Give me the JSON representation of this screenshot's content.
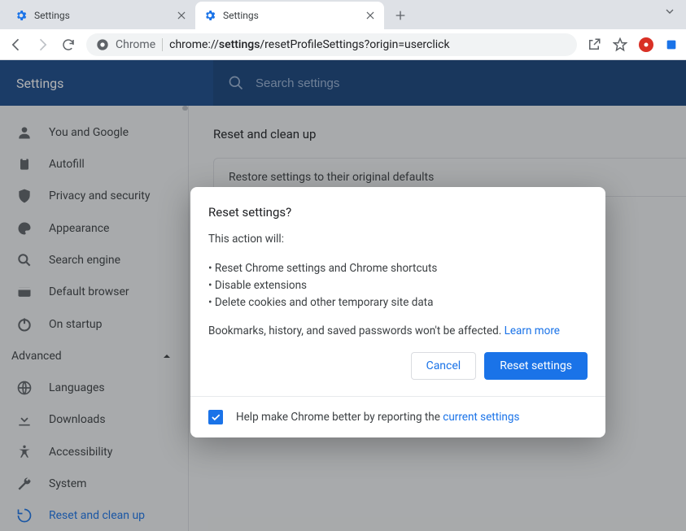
{
  "tabs": [
    {
      "label": "Settings",
      "active": false
    },
    {
      "label": "Settings",
      "active": true
    }
  ],
  "address": {
    "scheme_label": "Chrome",
    "url_prefix": "chrome://",
    "url_bold": "settings",
    "url_rest": "/resetProfileSettings?origin=userclick"
  },
  "app": {
    "title": "Settings",
    "search_placeholder": "Search settings"
  },
  "sidebar": {
    "items": [
      {
        "icon": "person-icon",
        "label": "You and Google"
      },
      {
        "icon": "clipboard-icon",
        "label": "Autofill"
      },
      {
        "icon": "shield-icon",
        "label": "Privacy and security"
      },
      {
        "icon": "palette-icon",
        "label": "Appearance"
      },
      {
        "icon": "search-icon",
        "label": "Search engine"
      },
      {
        "icon": "browser-icon",
        "label": "Default browser"
      },
      {
        "icon": "power-icon",
        "label": "On startup"
      }
    ],
    "group_label": "Advanced",
    "advanced": [
      {
        "icon": "globe-icon",
        "label": "Languages"
      },
      {
        "icon": "download-icon",
        "label": "Downloads"
      },
      {
        "icon": "accessibility-icon",
        "label": "Accessibility"
      },
      {
        "icon": "wrench-icon",
        "label": "System"
      },
      {
        "icon": "restore-icon",
        "label": "Reset and clean up",
        "active": true
      }
    ]
  },
  "content": {
    "section_title": "Reset and clean up",
    "card_label": "Restore settings to their original defaults"
  },
  "dialog": {
    "title": "Reset settings?",
    "intro": "This action will:",
    "bullets": [
      "Reset Chrome settings and Chrome shortcuts",
      "Disable extensions",
      "Delete cookies and other temporary site data"
    ],
    "note_text": "Bookmarks, history, and saved passwords won't be affected. ",
    "note_link": "Learn more",
    "cancel_label": "Cancel",
    "confirm_label": "Reset settings",
    "footer_text": "Help make Chrome better by reporting the ",
    "footer_link": "current settings",
    "checkbox_checked": true
  }
}
